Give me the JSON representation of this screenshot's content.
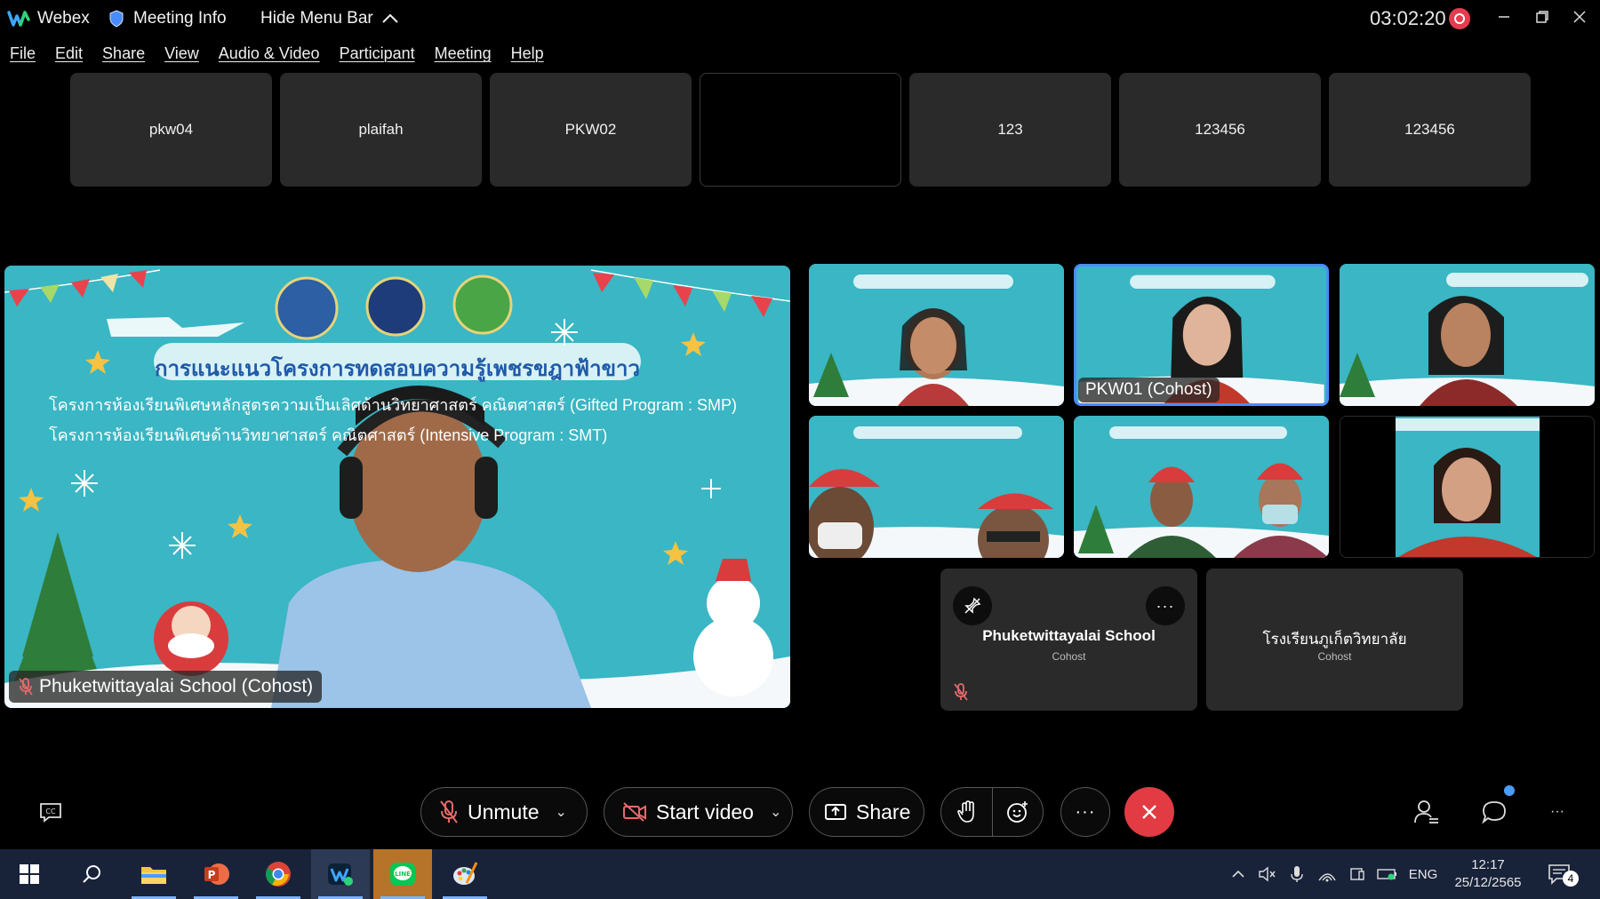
{
  "window": {
    "app_name": "Webex",
    "meeting_info": "Meeting Info",
    "hide_menu_bar": "Hide Menu Bar",
    "timer": "03:02:20"
  },
  "menu": [
    "File",
    "Edit",
    "Share",
    "View",
    "Audio & Video",
    "Participant",
    "Meeting",
    "Help"
  ],
  "thumbnails": [
    "pkw04",
    "plaifah",
    "PKW02",
    "",
    "123",
    "123456",
    "123456"
  ],
  "main_video": {
    "name": "Phuketwittayalai School (Cohost)",
    "banner_title": "การแนะแนวโครงการทดสอบความรู้เพชรขฎาฟ้าขาว",
    "banner_line1": "โครงการห้องเรียนพิเศษหลักสูตรความเป็นเลิศด้านวิทยาศาสตร์ คณิตศาสตร์ (Gifted Program : SMP)",
    "banner_line2": "โครงการห้องเรียนพิเศษด้านวิทยาศาสตร์ คณิตศาสตร์ (Intensive Program : SMT)"
  },
  "tiles": [
    {
      "label": ""
    },
    {
      "label": "PKW01 (Cohost)"
    },
    {
      "label": ""
    },
    {
      "label": ""
    },
    {
      "label": ""
    },
    {
      "label": ""
    }
  ],
  "avatar_cards": [
    {
      "name": "Phuketwittayalai School",
      "role": "Cohost"
    },
    {
      "name": "โรงเรียนภูเก็ตวิทยาลัย",
      "role": "Cohost"
    }
  ],
  "controls": {
    "unmute": "Unmute",
    "start_video": "Start video",
    "share": "Share"
  },
  "taskbar": {
    "language": "ENG",
    "time": "12:17",
    "date": "25/12/2565",
    "notifications": "4"
  },
  "colors": {
    "accent_blue": "#4a8cff",
    "end_call_red": "#e23b43",
    "record_red": "#e53b50",
    "tile_bg": "#2a2a2a",
    "slide_teal": "#3ab6c4"
  }
}
